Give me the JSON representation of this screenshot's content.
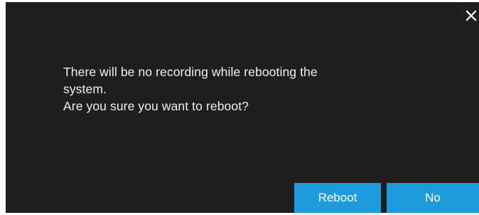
{
  "dialog": {
    "message_lines": [
      "There will be no recording while rebooting the",
      "system.",
      "Are you sure you want to reboot?"
    ],
    "close_icon": "close-icon",
    "buttons": {
      "reboot_label": "Reboot",
      "no_label": "No"
    }
  },
  "colors": {
    "background": "#1f1f1f",
    "text": "#f0f0f0",
    "button": "#1e9bdc",
    "button_text": "#ffffff"
  }
}
